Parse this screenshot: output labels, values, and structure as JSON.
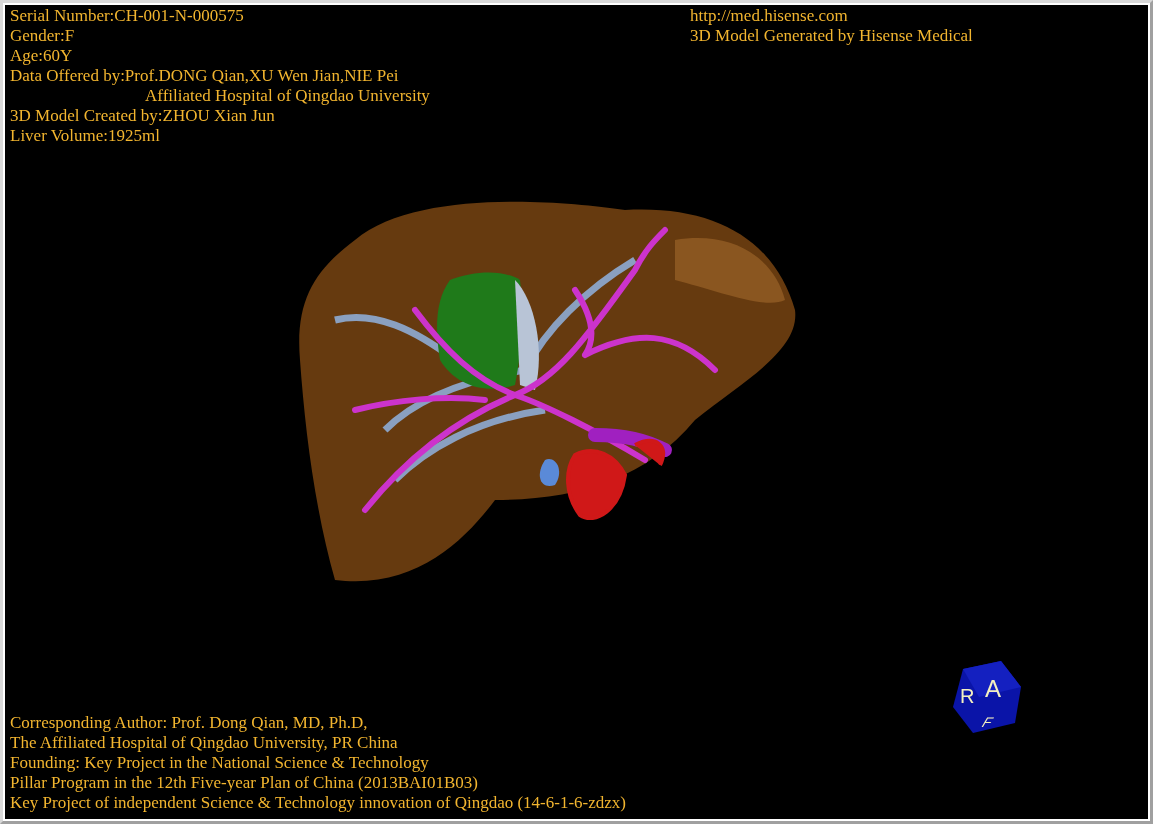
{
  "viewport": {
    "info_left": [
      {
        "kind": "line",
        "text": "Serial Number:CH-001-N-000575"
      },
      {
        "kind": "line",
        "text": "Gender:F"
      },
      {
        "kind": "line",
        "text": "Age:60Y"
      },
      {
        "kind": "line",
        "text": "Data Offered by:Prof.DONG Qian,XU Wen Jian,NIE Pei"
      },
      {
        "kind": "continuation",
        "text": "Affiliated Hospital of Qingdao University"
      },
      {
        "kind": "line",
        "text": "3D Model Created by:ZHOU Xian Jun"
      },
      {
        "kind": "line",
        "text": "Liver Volume:1925ml"
      }
    ],
    "info_right": [
      "http://med.hisense.com",
      "3D Model Generated by Hisense Medical"
    ],
    "credits": [
      "Corresponding Author: Prof. Dong Qian, MD, Ph.D,",
      "The Affiliated Hospital of Qingdao University, PR China",
      "Founding: Key Project in the National Science & Technology",
      "Pillar Program in the 12th Five-year Plan of China (2013BAI01B03)",
      "Key Project of independent Science & Technology innovation of Qingdao (14-6-1-6-zdzx)"
    ],
    "orientation_cube": {
      "labels": [
        "R",
        "A",
        "F"
      ]
    }
  }
}
